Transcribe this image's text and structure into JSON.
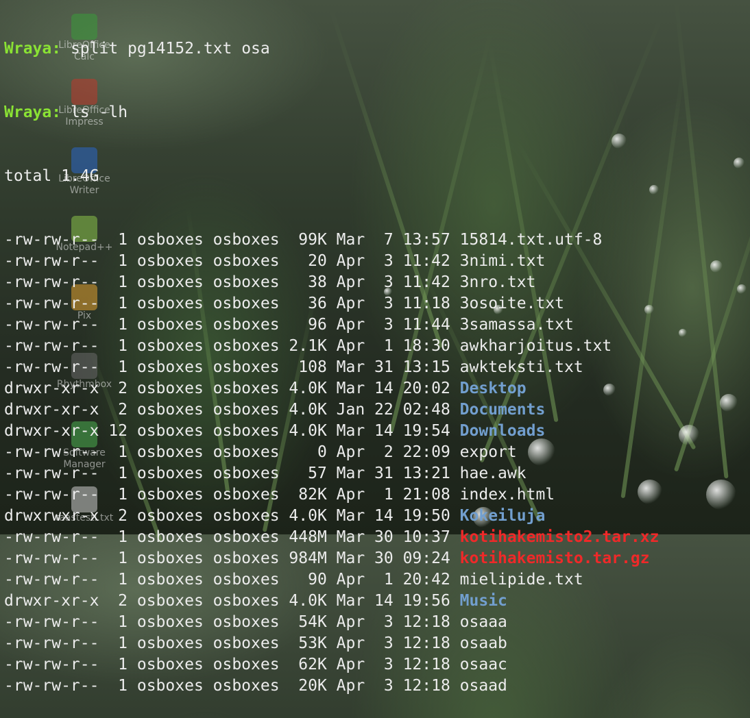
{
  "prompt_user": "Wraya:",
  "commands": [
    "split pg14152.txt osa",
    "ls -lh"
  ],
  "total_line": "total 1.4G",
  "desktop_icons": [
    {
      "label": "LibreOffice Calc",
      "icon": "spreadsheet-icon",
      "color": "#3a9a3a"
    },
    {
      "label": "LibreOffice Impress",
      "icon": "presentation-icon",
      "color": "#c0392b"
    },
    {
      "label": "LibreOffice Writer",
      "icon": "document-icon",
      "color": "#2a66c8"
    },
    {
      "label": "Notepad++",
      "icon": "notepad-icon",
      "color": "#8bc34a"
    },
    {
      "label": "Pix",
      "icon": "photos-icon",
      "color": "#e0a030"
    },
    {
      "label": "Rhythmbox",
      "icon": "music-icon",
      "color": "#6a6a6a"
    },
    {
      "label": "Software Manager",
      "icon": "software-manager-icon",
      "color": "#4caf50"
    },
    {
      "label": "taastesti.txt",
      "icon": "text-file-icon",
      "color": "#cccccc"
    }
  ],
  "colors": {
    "prompt": "#8ae234",
    "directory": "#729fcf",
    "archive": "#ef2929",
    "text": "#ececec"
  },
  "entries": [
    {
      "perm": "-rw-rw-r--",
      "links": "1",
      "owner": "osboxes",
      "group": "osboxes",
      "size": "99K",
      "month": "Mar",
      "day": "7",
      "time": "13:57",
      "name": "15814.txt.utf-8",
      "kind": "file"
    },
    {
      "perm": "-rw-rw-r--",
      "links": "1",
      "owner": "osboxes",
      "group": "osboxes",
      "size": "20",
      "month": "Apr",
      "day": "3",
      "time": "11:42",
      "name": "3nimi.txt",
      "kind": "file"
    },
    {
      "perm": "-rw-rw-r--",
      "links": "1",
      "owner": "osboxes",
      "group": "osboxes",
      "size": "38",
      "month": "Apr",
      "day": "3",
      "time": "11:42",
      "name": "3nro.txt",
      "kind": "file"
    },
    {
      "perm": "-rw-rw-r--",
      "links": "1",
      "owner": "osboxes",
      "group": "osboxes",
      "size": "36",
      "month": "Apr",
      "day": "3",
      "time": "11:18",
      "name": "3osoite.txt",
      "kind": "file"
    },
    {
      "perm": "-rw-rw-r--",
      "links": "1",
      "owner": "osboxes",
      "group": "osboxes",
      "size": "96",
      "month": "Apr",
      "day": "3",
      "time": "11:44",
      "name": "3samassa.txt",
      "kind": "file"
    },
    {
      "perm": "-rw-rw-r--",
      "links": "1",
      "owner": "osboxes",
      "group": "osboxes",
      "size": "2.1K",
      "month": "Apr",
      "day": "1",
      "time": "18:30",
      "name": "awkharjoitus.txt",
      "kind": "file"
    },
    {
      "perm": "-rw-rw-r--",
      "links": "1",
      "owner": "osboxes",
      "group": "osboxes",
      "size": "108",
      "month": "Mar",
      "day": "31",
      "time": "13:15",
      "name": "awkteksti.txt",
      "kind": "file"
    },
    {
      "perm": "drwxr-xr-x",
      "links": "2",
      "owner": "osboxes",
      "group": "osboxes",
      "size": "4.0K",
      "month": "Mar",
      "day": "14",
      "time": "20:02",
      "name": "Desktop",
      "kind": "dir"
    },
    {
      "perm": "drwxr-xr-x",
      "links": "2",
      "owner": "osboxes",
      "group": "osboxes",
      "size": "4.0K",
      "month": "Jan",
      "day": "22",
      "time": "02:48",
      "name": "Documents",
      "kind": "dir"
    },
    {
      "perm": "drwxr-xr-x",
      "links": "12",
      "owner": "osboxes",
      "group": "osboxes",
      "size": "4.0K",
      "month": "Mar",
      "day": "14",
      "time": "19:54",
      "name": "Downloads",
      "kind": "dir"
    },
    {
      "perm": "-rw-rw-r--",
      "links": "1",
      "owner": "osboxes",
      "group": "osboxes",
      "size": "0",
      "month": "Apr",
      "day": "2",
      "time": "22:09",
      "name": "export",
      "kind": "file"
    },
    {
      "perm": "-rw-rw-r--",
      "links": "1",
      "owner": "osboxes",
      "group": "osboxes",
      "size": "57",
      "month": "Mar",
      "day": "31",
      "time": "13:21",
      "name": "hae.awk",
      "kind": "file"
    },
    {
      "perm": "-rw-rw-r--",
      "links": "1",
      "owner": "osboxes",
      "group": "osboxes",
      "size": "82K",
      "month": "Apr",
      "day": "1",
      "time": "21:08",
      "name": "index.html",
      "kind": "file"
    },
    {
      "perm": "drwxrwxr-x",
      "links": "2",
      "owner": "osboxes",
      "group": "osboxes",
      "size": "4.0K",
      "month": "Mar",
      "day": "14",
      "time": "19:50",
      "name": "Kokeiluja",
      "kind": "dir"
    },
    {
      "perm": "-rw-rw-r--",
      "links": "1",
      "owner": "osboxes",
      "group": "osboxes",
      "size": "448M",
      "month": "Mar",
      "day": "30",
      "time": "10:37",
      "name": "kotihakemisto2.tar.xz",
      "kind": "archive"
    },
    {
      "perm": "-rw-rw-r--",
      "links": "1",
      "owner": "osboxes",
      "group": "osboxes",
      "size": "984M",
      "month": "Mar",
      "day": "30",
      "time": "09:24",
      "name": "kotihakemisto.tar.gz",
      "kind": "archive"
    },
    {
      "perm": "-rw-rw-r--",
      "links": "1",
      "owner": "osboxes",
      "group": "osboxes",
      "size": "90",
      "month": "Apr",
      "day": "1",
      "time": "20:42",
      "name": "mielipide.txt",
      "kind": "file"
    },
    {
      "perm": "drwxr-xr-x",
      "links": "2",
      "owner": "osboxes",
      "group": "osboxes",
      "size": "4.0K",
      "month": "Mar",
      "day": "14",
      "time": "19:56",
      "name": "Music",
      "kind": "dir"
    },
    {
      "perm": "-rw-rw-r--",
      "links": "1",
      "owner": "osboxes",
      "group": "osboxes",
      "size": "54K",
      "month": "Apr",
      "day": "3",
      "time": "12:18",
      "name": "osaaa",
      "kind": "file"
    },
    {
      "perm": "-rw-rw-r--",
      "links": "1",
      "owner": "osboxes",
      "group": "osboxes",
      "size": "53K",
      "month": "Apr",
      "day": "3",
      "time": "12:18",
      "name": "osaab",
      "kind": "file"
    },
    {
      "perm": "-rw-rw-r--",
      "links": "1",
      "owner": "osboxes",
      "group": "osboxes",
      "size": "62K",
      "month": "Apr",
      "day": "3",
      "time": "12:18",
      "name": "osaac",
      "kind": "file"
    },
    {
      "perm": "-rw-rw-r--",
      "links": "1",
      "owner": "osboxes",
      "group": "osboxes",
      "size": "20K",
      "month": "Apr",
      "day": "3",
      "time": "12:18",
      "name": "osaad",
      "kind": "file"
    }
  ]
}
